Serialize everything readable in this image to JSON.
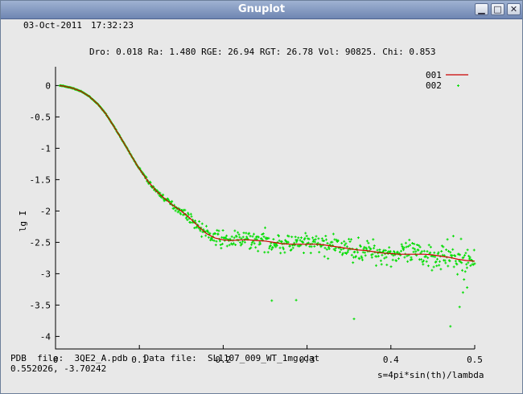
{
  "window": {
    "title": "Gnuplot",
    "minimize_glyph": "▁",
    "maximize_glyph": "□",
    "close_glyph": "✕"
  },
  "header": {
    "date": "03-Oct-2011",
    "time": "17:32:23",
    "stats": "Dro: 0.018  Ra: 1.480  RGE:  26.94  RGT: 26.78  Vol:  90825.  Chi:  0.853"
  },
  "footer": {
    "files": "PDB  file:  3QE2_A.pdb   Data file:  SL1107_009_WT_1mg.dat",
    "coords": "0.552026, -3.70242"
  },
  "colors": {
    "fit": "#cc0000",
    "data": "#00dd00"
  },
  "chart_data": {
    "type": "line",
    "xlabel": "s=4pi*sin(th)/lambda",
    "ylabel": "lg I",
    "xlim": [
      0,
      0.5
    ],
    "ylim": [
      -4.2,
      0.3
    ],
    "xticks": [
      "0",
      "0.1",
      "0.2",
      "0.3",
      "0.4",
      "0.5"
    ],
    "yticks": [
      "0",
      "-0.5",
      "-1",
      "-1.5",
      "-2",
      "-2.5",
      "-3",
      "-3.5",
      "-4"
    ],
    "legend_position": "top-right",
    "series": [
      {
        "name": "001",
        "style": "line",
        "x": [
          0.005,
          0.01,
          0.02,
          0.03,
          0.04,
          0.05,
          0.06,
          0.07,
          0.08,
          0.09,
          0.1,
          0.11,
          0.12,
          0.13,
          0.14,
          0.15,
          0.16,
          0.17,
          0.18,
          0.19,
          0.2,
          0.21,
          0.22,
          0.23,
          0.24,
          0.25,
          0.26,
          0.27,
          0.28,
          0.29,
          0.3,
          0.31,
          0.32,
          0.33,
          0.34,
          0.35,
          0.36,
          0.37,
          0.38,
          0.39,
          0.4,
          0.41,
          0.42,
          0.43,
          0.44,
          0.45,
          0.46,
          0.47,
          0.48,
          0.49,
          0.5
        ],
        "y": [
          0.0,
          -0.01,
          -0.04,
          -0.09,
          -0.17,
          -0.29,
          -0.45,
          -0.66,
          -0.88,
          -1.11,
          -1.33,
          -1.52,
          -1.68,
          -1.8,
          -1.91,
          -2.0,
          -2.11,
          -2.24,
          -2.36,
          -2.43,
          -2.46,
          -2.47,
          -2.46,
          -2.46,
          -2.47,
          -2.48,
          -2.5,
          -2.52,
          -2.53,
          -2.53,
          -2.53,
          -2.53,
          -2.54,
          -2.56,
          -2.58,
          -2.6,
          -2.62,
          -2.63,
          -2.65,
          -2.67,
          -2.68,
          -2.69,
          -2.69,
          -2.69,
          -2.69,
          -2.7,
          -2.72,
          -2.74,
          -2.77,
          -2.79,
          -2.8
        ]
      },
      {
        "name": "002",
        "style": "points",
        "x_start": 0.005,
        "x_end": 0.5,
        "count": 700,
        "seed": 7,
        "noise": [
          {
            "x": 0.12,
            "y": 0.03
          },
          {
            "x": 0.16,
            "y": 0.06
          },
          {
            "x": 0.19,
            "y": 0.12
          },
          {
            "x": 0.25,
            "y": 0.14
          },
          {
            "x": 0.35,
            "y": 0.16
          },
          {
            "x": 0.45,
            "y": 0.2
          },
          {
            "x": 0.5,
            "y": 0.26
          }
        ],
        "outliers": [
          {
            "x": 0.258,
            "y": -3.43
          },
          {
            "x": 0.287,
            "y": -3.42
          },
          {
            "x": 0.356,
            "y": -3.72
          },
          {
            "x": 0.471,
            "y": -3.84
          },
          {
            "x": 0.482,
            "y": -3.53
          },
          {
            "x": 0.486,
            "y": -3.3
          },
          {
            "x": 0.491,
            "y": -3.22
          }
        ]
      }
    ]
  }
}
